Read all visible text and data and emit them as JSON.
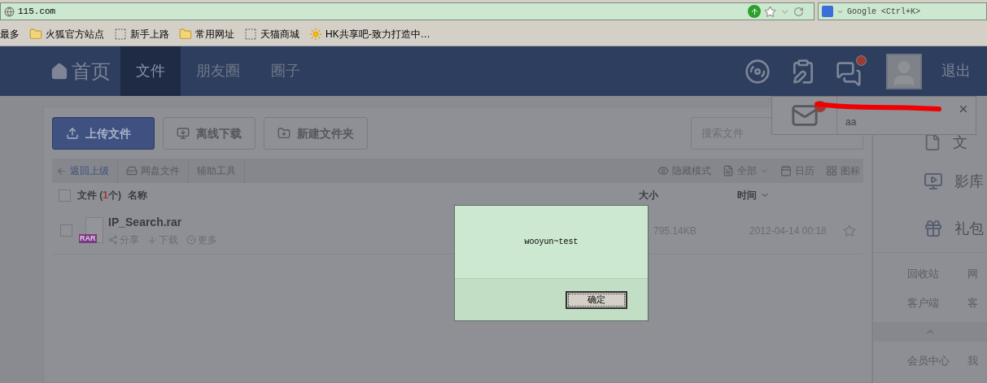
{
  "browser": {
    "url": "115.com",
    "search_placeholder": "Google <Ctrl+K>",
    "bookmarks": [
      {
        "label": "最多",
        "kind": "plain"
      },
      {
        "label": "火狐官方站点",
        "kind": "folder"
      },
      {
        "label": "新手上路",
        "kind": "page"
      },
      {
        "label": "常用网址",
        "kind": "folder"
      },
      {
        "label": "天猫商城",
        "kind": "page"
      },
      {
        "label": "HK共享吧-致力打造中…",
        "kind": "favicon"
      }
    ]
  },
  "nav": {
    "home": "首页",
    "tabs": [
      {
        "label": "文件",
        "selected": true
      },
      {
        "label": "朋友圈",
        "selected": false
      },
      {
        "label": "圈子",
        "selected": false
      }
    ],
    "messages_unread": true,
    "logout": "退出"
  },
  "notification": {
    "message": "aa",
    "unread": true
  },
  "toolbar": {
    "buttons": [
      {
        "label": "上传文件",
        "kind": "primary"
      },
      {
        "label": "离线下载",
        "kind": "secondary"
      },
      {
        "label": "新建文件夹",
        "kind": "secondary"
      }
    ],
    "search_placeholder": "搜索文件"
  },
  "breadcrumb": {
    "back": "返回上级",
    "items": [
      "网盘文件",
      "辅助工具"
    ],
    "actions": [
      {
        "label": "隐藏模式",
        "kind": "eye"
      },
      {
        "label": "全部",
        "kind": "filter"
      },
      {
        "label": "日历",
        "kind": "calendar"
      },
      {
        "label": "图标",
        "kind": "grid"
      }
    ]
  },
  "table": {
    "all_checked": false,
    "file_label": "文件 (",
    "file_count": "1",
    "file_unit": "个)",
    "columns": [
      "名称",
      "大小",
      "时间"
    ],
    "rows": [
      {
        "type_badge": "RAR",
        "name": "IP_Search.rar",
        "size": "795.14KB",
        "time": "2012-04-14 00:18",
        "checked": false,
        "starred": false,
        "actions": [
          "分享",
          "下载",
          "更多"
        ]
      }
    ]
  },
  "sidebar": {
    "items": [
      {
        "label": "文",
        "kind": "file"
      },
      {
        "label": "影库",
        "kind": "video"
      },
      {
        "label": "礼包",
        "kind": "gift"
      }
    ],
    "links": [
      "回收站",
      "网",
      "客户端",
      "客"
    ],
    "member_links": [
      "会员中心",
      "我"
    ]
  },
  "dialog": {
    "message": "wooyun~test",
    "ok": "确定"
  }
}
